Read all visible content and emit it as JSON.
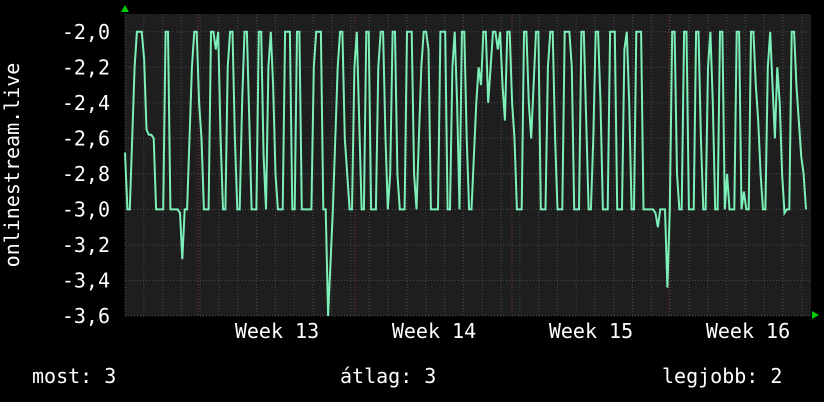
{
  "chart_data": {
    "type": "line",
    "ylabel": "onlinestream.live",
    "ylim": [
      -3.6,
      -1.9
    ],
    "y_ticks": [
      "-2,0",
      "-2,2",
      "-2,4",
      "-2,6",
      "-2,8",
      "-3,0",
      "-3,2",
      "-3,4",
      "-3,6"
    ],
    "y_tick_values": [
      -2.0,
      -2.2,
      -2.4,
      -2.6,
      -2.8,
      -3.0,
      -3.2,
      -3.4,
      -3.6
    ],
    "x_ticks": [
      "Week 13",
      "Week 14",
      "Week 15",
      "Week 16"
    ],
    "grid": true,
    "colors": {
      "line": "#7cf0b8",
      "background": "#000000",
      "plot_bg": "#1e1e1e",
      "grid": "#4a4a4a",
      "axis_arrow": "#00cc00"
    },
    "series": [
      {
        "values": [
          -2.68,
          -3.0,
          -3.0,
          -2.6,
          -2.2,
          -2.0,
          -2.0,
          -2.0,
          -2.15,
          -2.55,
          -2.58,
          -2.58,
          -2.6,
          -3.0,
          -3.0,
          -3.0,
          -3.0,
          -2.0,
          -2.0,
          -3.0,
          -3.0,
          -3.0,
          -3.0,
          -3.02,
          -3.28,
          -3.0,
          -3.0,
          -2.6,
          -2.2,
          -2.0,
          -2.0,
          -2.4,
          -2.6,
          -3.0,
          -3.0,
          -3.0,
          -2.0,
          -2.0,
          -2.1,
          -2.0,
          -2.6,
          -3.0,
          -3.0,
          -2.2,
          -2.0,
          -2.0,
          -2.6,
          -3.0,
          -3.0,
          -2.4,
          -2.0,
          -2.0,
          -2.5,
          -3.0,
          -3.0,
          -3.0,
          -2.0,
          -2.0,
          -2.7,
          -3.0,
          -2.2,
          -2.0,
          -2.3,
          -2.8,
          -3.0,
          -3.0,
          -3.0,
          -2.0,
          -2.0,
          -2.0,
          -3.0,
          -3.0,
          -2.0,
          -2.0,
          -3.0,
          -3.0,
          -3.0,
          -3.0,
          -3.0,
          -2.2,
          -2.0,
          -2.0,
          -2.0,
          -3.0,
          -3.0,
          -3.6,
          -3.3,
          -3.0,
          -2.6,
          -2.2,
          -2.0,
          -2.0,
          -2.6,
          -2.8,
          -3.0,
          -3.0,
          -2.2,
          -2.0,
          -2.5,
          -3.0,
          -3.0,
          -2.0,
          -2.0,
          -3.0,
          -3.0,
          -3.0,
          -2.2,
          -2.0,
          -2.0,
          -2.6,
          -3.0,
          -2.8,
          -2.0,
          -2.0,
          -2.8,
          -3.0,
          -3.0,
          -3.0,
          -2.0,
          -2.0,
          -2.0,
          -2.8,
          -3.0,
          -2.6,
          -2.2,
          -2.0,
          -2.0,
          -2.1,
          -3.0,
          -3.0,
          -3.0,
          -3.0,
          -2.0,
          -2.0,
          -2.0,
          -3.0,
          -3.0,
          -2.2,
          -2.0,
          -2.4,
          -3.0,
          -2.0,
          -2.0,
          -2.6,
          -3.0,
          -3.0,
          -2.7,
          -2.4,
          -2.2,
          -2.3,
          -2.0,
          -2.0,
          -2.4,
          -2.2,
          -2.0,
          -2.0,
          -2.1,
          -2.0,
          -2.3,
          -2.5,
          -2.0,
          -2.0,
          -2.4,
          -2.6,
          -3.0,
          -3.0,
          -3.0,
          -2.0,
          -2.0,
          -2.4,
          -2.6,
          -2.3,
          -2.0,
          -2.0,
          -3.0,
          -3.0,
          -3.0,
          -2.2,
          -2.0,
          -2.0,
          -2.6,
          -3.0,
          -3.0,
          -3.0,
          -2.0,
          -2.0,
          -2.0,
          -2.2,
          -3.0,
          -3.0,
          -3.0,
          -2.0,
          -2.0,
          -2.5,
          -3.0,
          -3.0,
          -2.6,
          -2.0,
          -2.0,
          -2.4,
          -3.0,
          -3.0,
          -3.0,
          -2.0,
          -2.0,
          -2.0,
          -3.0,
          -3.0,
          -3.0,
          -2.1,
          -2.0,
          -2.4,
          -3.0,
          -3.0,
          -2.0,
          -2.0,
          -2.0,
          -3.0,
          -3.0,
          -3.0,
          -3.0,
          -3.0,
          -3.02,
          -3.1,
          -3.0,
          -3.0,
          -3.0,
          -3.44,
          -3.0,
          -2.0,
          -2.0,
          -2.8,
          -3.0,
          -3.0,
          -2.0,
          -2.0,
          -3.0,
          -3.0,
          -3.0,
          -2.0,
          -2.0,
          -2.6,
          -3.0,
          -3.0,
          -2.2,
          -2.0,
          -2.4,
          -3.0,
          -3.0,
          -2.0,
          -2.0,
          -3.0,
          -2.8,
          -3.0,
          -3.0,
          -3.0,
          -2.0,
          -2.0,
          -3.0,
          -2.9,
          -3.0,
          -3.0,
          -2.0,
          -2.0,
          -2.3,
          -2.5,
          -2.8,
          -3.0,
          -3.0,
          -2.2,
          -2.0,
          -2.3,
          -2.6,
          -2.2,
          -2.4,
          -2.8,
          -3.02,
          -3.0,
          -3.0,
          -2.0,
          -2.0,
          -2.3,
          -2.5,
          -2.7,
          -2.8,
          -3.0
        ]
      }
    ]
  },
  "legend": {
    "current": "most: 3",
    "average": "átlag: 3",
    "best": "legjobb: 2"
  }
}
